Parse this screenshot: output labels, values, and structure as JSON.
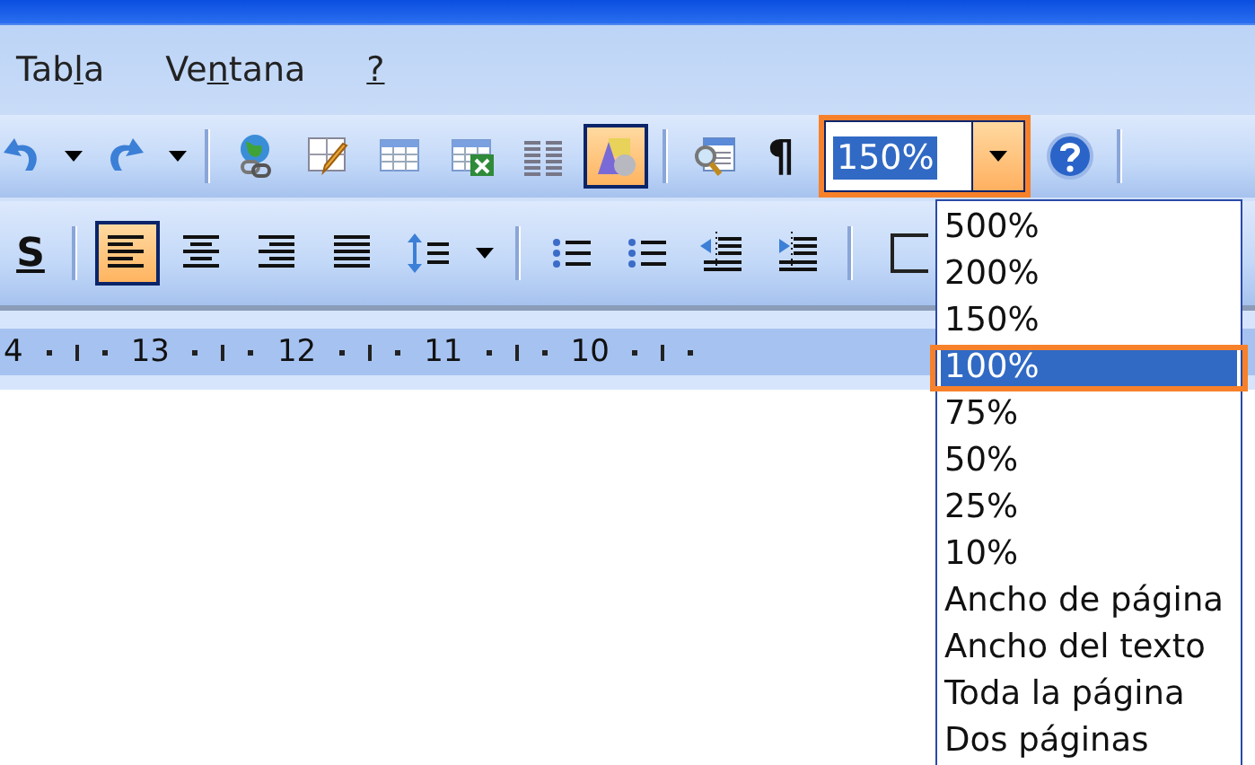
{
  "menu_bar": {
    "items": [
      {
        "before": "Tab",
        "key": "l",
        "after": "a"
      },
      {
        "before": "Ve",
        "key": "n",
        "after": "tana"
      },
      {
        "key": "?"
      }
    ]
  },
  "standard_toolbar": {
    "items": [
      {
        "kind": "undo",
        "on": false
      },
      {
        "kind": "arrow",
        "on": false
      },
      {
        "kind": "redo",
        "on": false
      },
      {
        "kind": "arrow",
        "on": false
      },
      {
        "kind": "separator"
      },
      {
        "kind": "hyperlink",
        "on": false
      },
      {
        "kind": "draw-table",
        "on": false
      },
      {
        "kind": "table",
        "on": false
      },
      {
        "kind": "excel-table",
        "on": false
      },
      {
        "kind": "columns",
        "on": false
      },
      {
        "kind": "drawing",
        "on": true
      },
      {
        "kind": "separator"
      },
      {
        "kind": "preview",
        "on": false
      },
      {
        "kind": "text",
        "text": "¶",
        "on": false
      }
    ],
    "zoom_box": {
      "value": "150%",
      "highlighted": true
    },
    "after": [
      {
        "kind": "help",
        "on": false
      },
      {
        "kind": "separator"
      }
    ]
  },
  "formatting_toolbar": {
    "items": [
      {
        "kind": "underline",
        "text": "S",
        "on": false
      },
      {
        "kind": "separator"
      },
      {
        "kind": "align-left",
        "on": true
      },
      {
        "kind": "align-center",
        "on": false
      },
      {
        "kind": "align-right",
        "on": false
      },
      {
        "kind": "justify",
        "on": false
      },
      {
        "kind": "line-spacing",
        "on": false
      },
      {
        "kind": "arrow",
        "on": false
      },
      {
        "kind": "separator"
      },
      {
        "kind": "numbering",
        "on": false
      },
      {
        "kind": "bullets",
        "on": false
      },
      {
        "kind": "outdent",
        "on": false
      },
      {
        "kind": "indent",
        "on": false
      },
      {
        "kind": "separator"
      },
      {
        "kind": "border",
        "on": false
      }
    ]
  },
  "ruler": {
    "labels": [
      "4",
      "13",
      "12",
      "11",
      "10"
    ]
  },
  "zoom_list": {
    "options": [
      {
        "label": "500%",
        "selected": false,
        "highlighted": false
      },
      {
        "label": "200%",
        "selected": false,
        "highlighted": false
      },
      {
        "label": "150%",
        "selected": false,
        "highlighted": false
      },
      {
        "label": "100%",
        "selected": true,
        "highlighted": true
      },
      {
        "label": "75%",
        "selected": false,
        "highlighted": false
      },
      {
        "label": "50%",
        "selected": false,
        "highlighted": false
      },
      {
        "label": "25%",
        "selected": false,
        "highlighted": false
      },
      {
        "label": "10%",
        "selected": false,
        "highlighted": false
      },
      {
        "label": "Ancho de página",
        "selected": false,
        "highlighted": false
      },
      {
        "label": "Ancho del texto",
        "selected": false,
        "highlighted": false
      },
      {
        "label": "Toda la página",
        "selected": false,
        "highlighted": false
      },
      {
        "label": "Dos páginas",
        "selected": false,
        "highlighted": false
      }
    ]
  }
}
